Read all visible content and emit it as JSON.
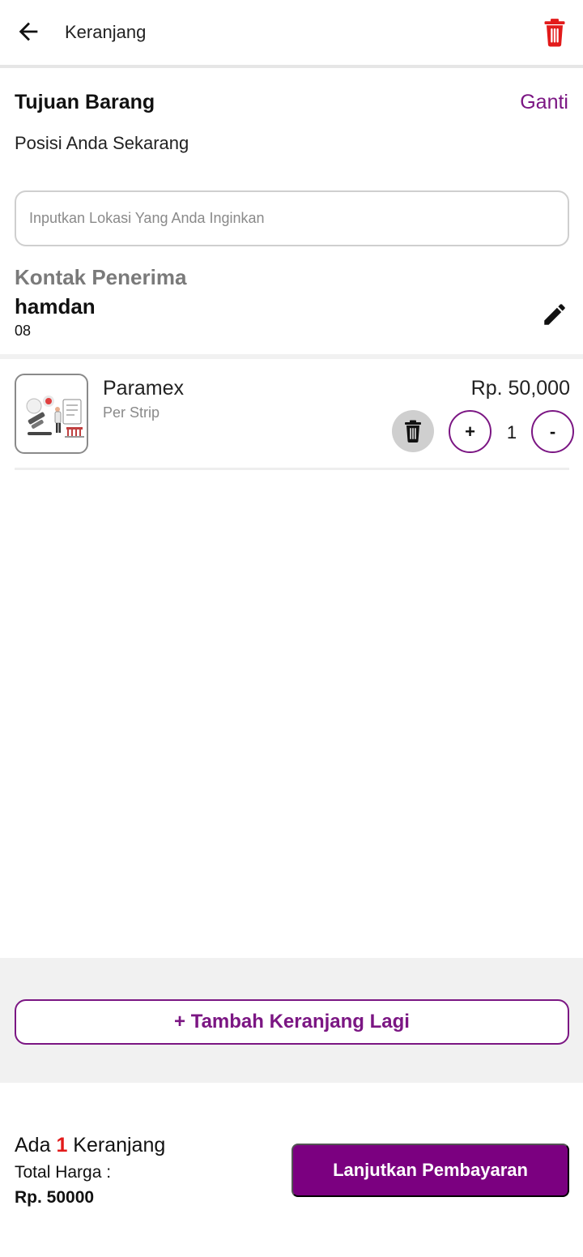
{
  "appbar": {
    "title": "Keranjang"
  },
  "destination": {
    "title": "Tujuan Barang",
    "change_label": "Ganti",
    "position_text": "Posisi Anda Sekarang",
    "input_placeholder": "Inputkan Lokasi Yang Anda Inginkan"
  },
  "contact": {
    "label": "Kontak Penerima",
    "name": "hamdan",
    "phone": "08"
  },
  "cart_item": {
    "name": "Paramex",
    "unit": "Per Strip",
    "price": "Rp. 50,000",
    "plus_label": "+",
    "quantity": "1",
    "minus_label": "-"
  },
  "add_more": {
    "label": "+ Tambah Keranjang Lagi"
  },
  "footer": {
    "count_prefix": "Ada ",
    "count_value": "1",
    "count_suffix": " Keranjang",
    "total_label": "Total Harga :",
    "total_value": "Rp. 50000",
    "pay_label": "Lanjutkan Pembayaran"
  },
  "colors": {
    "accent": "#7b1683",
    "button_primary": "#7b0080",
    "danger": "#e21a1a",
    "muted": "#7a7a7a"
  },
  "icons": [
    "arrow-left-icon",
    "trash-icon",
    "pencil-icon",
    "product-image"
  ]
}
